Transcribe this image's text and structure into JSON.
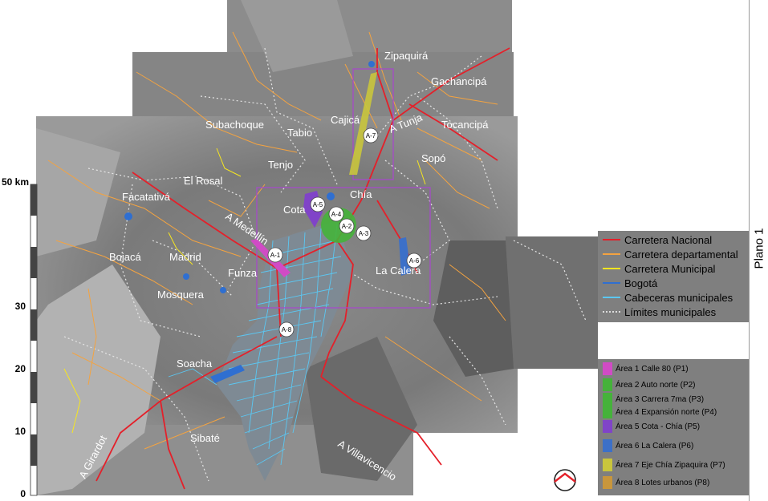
{
  "map": {
    "towns": [
      {
        "id": "zipaquira",
        "label": "Zipaquirá"
      },
      {
        "id": "gachancipa",
        "label": "Gachancipá"
      },
      {
        "id": "cajica",
        "label": "Cajicá"
      },
      {
        "id": "tocancipa",
        "label": "Tocancipá"
      },
      {
        "id": "subachoque",
        "label": "Subachoque"
      },
      {
        "id": "tabio",
        "label": "Tabio"
      },
      {
        "id": "sopo",
        "label": "Sopó"
      },
      {
        "id": "tenjo",
        "label": "Tenjo"
      },
      {
        "id": "el-rosal",
        "label": "El Rosal"
      },
      {
        "id": "facatativa",
        "label": "Facatativá"
      },
      {
        "id": "chia",
        "label": "Chía"
      },
      {
        "id": "cota",
        "label": "Cota"
      },
      {
        "id": "bojaca",
        "label": "Bojacá"
      },
      {
        "id": "madrid",
        "label": "Madrid"
      },
      {
        "id": "funza",
        "label": "Funza"
      },
      {
        "id": "la-calera",
        "label": "La Calera"
      },
      {
        "id": "mosquera",
        "label": "Mosquera"
      },
      {
        "id": "soacha",
        "label": "Soacha"
      },
      {
        "id": "sibate",
        "label": "Sibaté"
      }
    ],
    "routes": {
      "tunja": "A Tunja",
      "medellin": "A Medellín",
      "girardot": "A Girardot",
      "villavicencio": "A Villavicencio"
    },
    "markers": [
      "A-1",
      "A-2",
      "A-3",
      "A-4",
      "A-5",
      "A-6",
      "A-7",
      "A-8"
    ],
    "scale": {
      "unit_label": "50 km",
      "ticks": [
        "30",
        "20",
        "10",
        "0"
      ]
    }
  },
  "legend_roads": [
    {
      "label": "Carretera Nacional",
      "color": "#e4202a",
      "style": "solid"
    },
    {
      "label": "Carretera departamental",
      "color": "#f4a340",
      "style": "solid"
    },
    {
      "label": "Carretera Municipal",
      "color": "#f6e620",
      "style": "solid"
    },
    {
      "label": "Bogotá",
      "color": "#2f6fd1",
      "style": "solid"
    },
    {
      "label": "Cabeceras municipales",
      "color": "#5bc7f2",
      "style": "solid"
    },
    {
      "label": "Límites municipales",
      "color": "#dcdcdc",
      "style": "dotted"
    }
  ],
  "legend_areas": [
    {
      "label": "Área 1 Calle 80 (P1)",
      "color": "#d04bc5"
    },
    {
      "label": "Área 2 Auto norte (P2)",
      "color": "#45b23a"
    },
    {
      "label": "Área 3 Carrera 7ma (P3)",
      "color": "#45b23a"
    },
    {
      "label": "Área 4 Expansión norte (P4)",
      "color": "#45b23a"
    },
    {
      "label": "Área 5 Cota - Chía (P5)",
      "color": "#8044c8"
    },
    {
      "label": "Área 6 La Calera (P6)",
      "color": "#3c70c8"
    },
    {
      "label": "Área 7 Eje Chía Zipaquira (P7)",
      "color": "#c9c53c"
    },
    {
      "label": "Área 8 Lotes urbanos (P8)",
      "color": "#c8963c"
    }
  ],
  "plano": "Plano 1"
}
